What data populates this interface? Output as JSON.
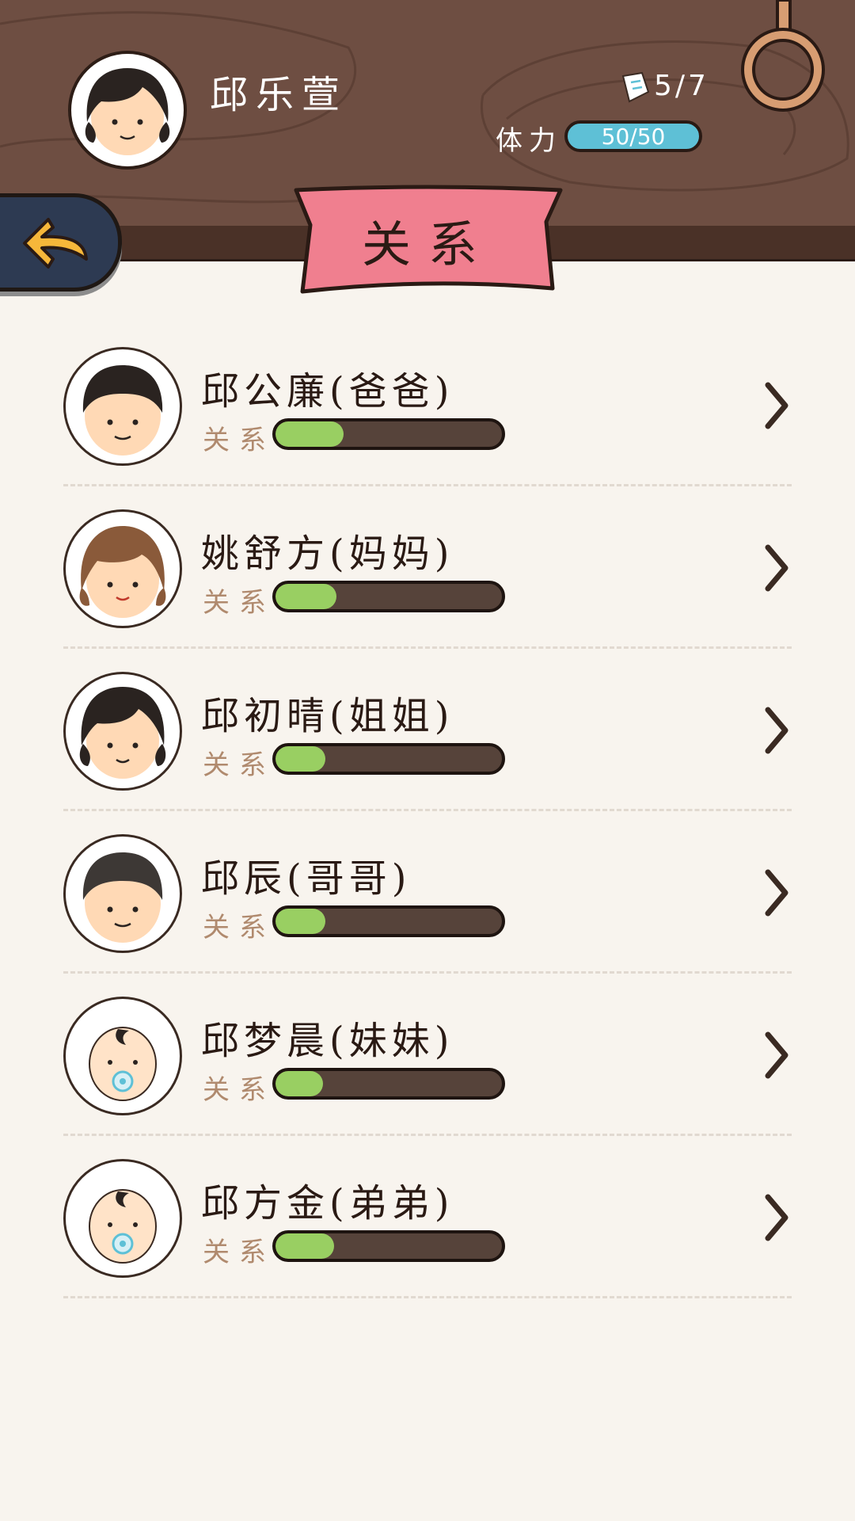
{
  "header": {
    "player_name": "邱乐萱",
    "tickets": "5/7",
    "stamina_label": "体力",
    "stamina_value": "50/50",
    "icons": [
      "player-avatar",
      "ticket-icon",
      "ring-icon"
    ]
  },
  "nav": {
    "back_icon": "back-arrow-icon",
    "title": "关系"
  },
  "relations": [
    {
      "name": "邱公廉(爸爸)",
      "label": "关系",
      "level": 0.3,
      "avatar": "father"
    },
    {
      "name": "姚舒方(妈妈)",
      "label": "关系",
      "level": 0.27,
      "avatar": "mother"
    },
    {
      "name": "邱初晴(姐姐)",
      "label": "关系",
      "level": 0.22,
      "avatar": "sister"
    },
    {
      "name": "邱辰(哥哥)",
      "label": "关系",
      "level": 0.22,
      "avatar": "brother"
    },
    {
      "name": "邱梦晨(妹妹)",
      "label": "关系",
      "level": 0.21,
      "avatar": "baby"
    },
    {
      "name": "邱方金(弟弟)",
      "label": "关系",
      "level": 0.26,
      "avatar": "baby"
    }
  ],
  "colors": {
    "wood": "#6e4e42",
    "banner": "#f07f8f",
    "bar_fill": "#99cf62",
    "stamina": "#5ec0d6"
  }
}
